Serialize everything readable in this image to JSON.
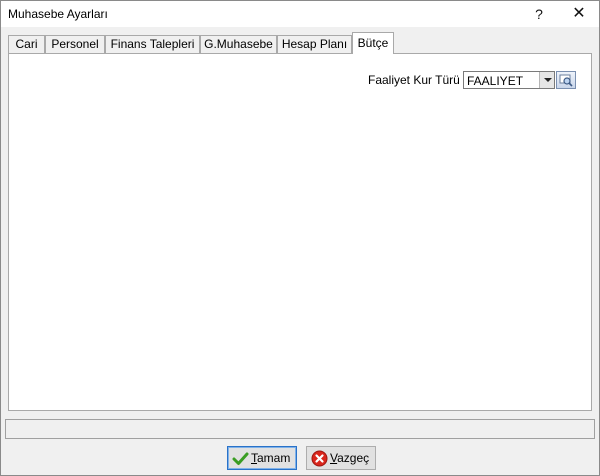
{
  "window": {
    "title": "Muhasebe Ayarları",
    "help_glyph": "?",
    "close_glyph": "✕"
  },
  "tabs": [
    {
      "label": "Cari",
      "active": false
    },
    {
      "label": "Personel",
      "active": false
    },
    {
      "label": "Finans Talepleri",
      "active": false
    },
    {
      "label": "G.Muhasebe",
      "active": false
    },
    {
      "label": "Hesap Planı",
      "active": false
    },
    {
      "label": "Bütçe",
      "active": true
    }
  ],
  "budget": {
    "field_label": "Faaliyet Kur Türü",
    "field_value": "FAALIYET"
  },
  "buttons": {
    "ok_label": "Tamam",
    "cancel_label": "Vazgeç"
  },
  "colors": {
    "ok_icon": "#3a9d23",
    "cancel_icon": "#d9261c",
    "focus_border": "#2a72c8"
  }
}
